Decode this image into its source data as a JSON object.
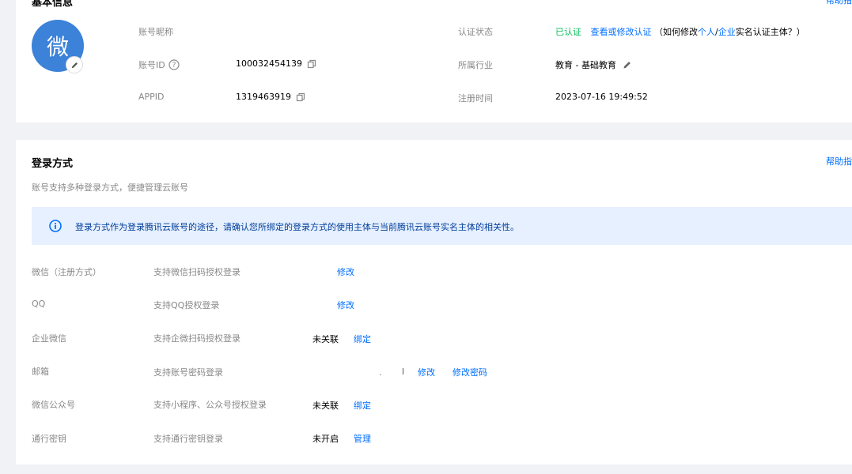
{
  "basic": {
    "title": "基本信息",
    "help": "帮助指",
    "avatar_char": "微",
    "nickname_label": "账号昵称",
    "account_id_label": "账号ID",
    "account_id": "100032454139",
    "appid_label": "APPID",
    "appid": "1319463919",
    "auth_label": "认证状态",
    "auth_status": "已认证",
    "auth_view": "查看或修改认证",
    "auth_hint_open": "（如何修改",
    "auth_personal": "个人",
    "auth_sep": "/",
    "auth_enterprise": "企业",
    "auth_hint_close": "实名认证主体？）",
    "industry_label": "所属行业",
    "industry": "教育 - 基础教育",
    "reg_label": "注册时间",
    "reg_time": "2023-07-16 19:49:52"
  },
  "login": {
    "title": "登录方式",
    "help": "帮助指",
    "subtitle": "账号支持多种登录方式，便捷管理云账号",
    "notice": "登录方式作为登录腾讯云账号的途径，请确认您所绑定的登录方式的使用主体与当前腾讯云账号实名主体的相关性。",
    "rows": [
      {
        "name": "微信（注册方式）",
        "desc": "支持微信扫码授权登录",
        "status": "",
        "action": "修改",
        "action2": ""
      },
      {
        "name": "QQ",
        "desc": "支持QQ授权登录",
        "status": "",
        "action": "修改",
        "action2": ""
      },
      {
        "name": "企业微信",
        "desc": "支持企微扫码授权登录",
        "status": "未关联",
        "action": "绑定",
        "action2": ""
      },
      {
        "name": "邮箱",
        "desc": "支持账号密码登录",
        "status": "",
        "action": "修改",
        "action2": "修改密码"
      },
      {
        "name": "微信公众号",
        "desc": "支持小程序、公众号授权登录",
        "status": "未关联",
        "action": "绑定",
        "action2": ""
      },
      {
        "name": "通行密钥",
        "desc": "支持通行密钥登录",
        "status": "未开启",
        "action": "管理",
        "action2": ""
      }
    ]
  }
}
